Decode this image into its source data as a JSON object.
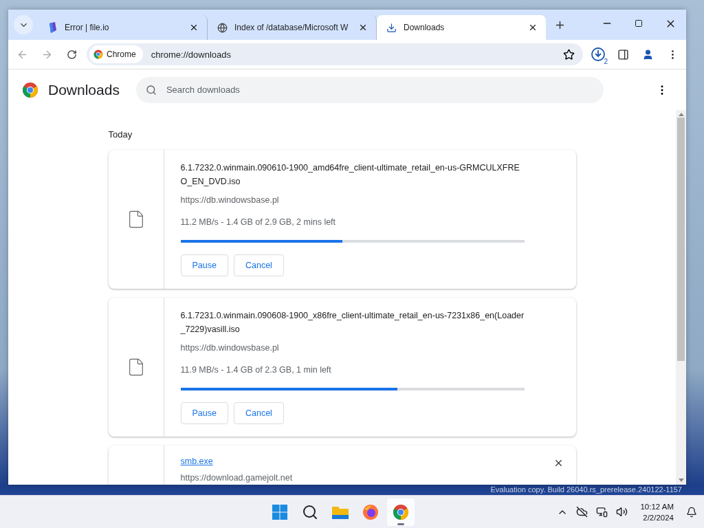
{
  "browser": {
    "tabs": [
      {
        "title": "Error | file.io",
        "selected": false
      },
      {
        "title": "Index of /database/Microsoft W",
        "selected": false
      },
      {
        "title": "Downloads",
        "selected": true
      }
    ],
    "address": {
      "chip": "Chrome",
      "url": "chrome://downloads"
    },
    "downloads_badge": "2"
  },
  "page": {
    "title": "Downloads",
    "search": {
      "placeholder": "Search downloads"
    },
    "section": "Today",
    "downloads": [
      {
        "kind": "progress",
        "name": "6.1.7232.0.winmain.090610-1900_amd64fre_client-ultimate_retail_en-us-GRMCULXFREO_EN_DVD.iso",
        "source": "https://db.windowsbase.pl",
        "status": "11.2 MB/s - 1.4 GB of 2.9 GB, 2 mins left",
        "level": 0.47,
        "buttons": [
          "Pause",
          "Cancel"
        ]
      },
      {
        "kind": "progress",
        "name": "6.1.7231.0.winmain.090608-1900_x86fre_client-ultimate_retail_en-us-7231x86_en(Loader_7229)vasill.iso",
        "source": "https://db.windowsbase.pl",
        "status": "11.9 MB/s - 1.4 GB of 2.3 GB, 1 min left",
        "level": 0.63,
        "buttons": [
          "Pause",
          "Cancel"
        ]
      },
      {
        "kind": "done",
        "name": "smb.exe",
        "source": "https://download.gamejolt.net"
      }
    ]
  },
  "desktop": {
    "watermark": "Evaluation copy. Build 26040.rs_prerelease.240122-1157"
  },
  "taskbar": {
    "apps": [
      {
        "kind": "start",
        "selected": false
      },
      {
        "kind": "search",
        "selected": false
      },
      {
        "kind": "explorer",
        "selected": false
      },
      {
        "kind": "firefox",
        "selected": false
      },
      {
        "kind": "chrome",
        "selected": true
      }
    ],
    "time": "10:12 AM",
    "date": "2/2/2024"
  }
}
